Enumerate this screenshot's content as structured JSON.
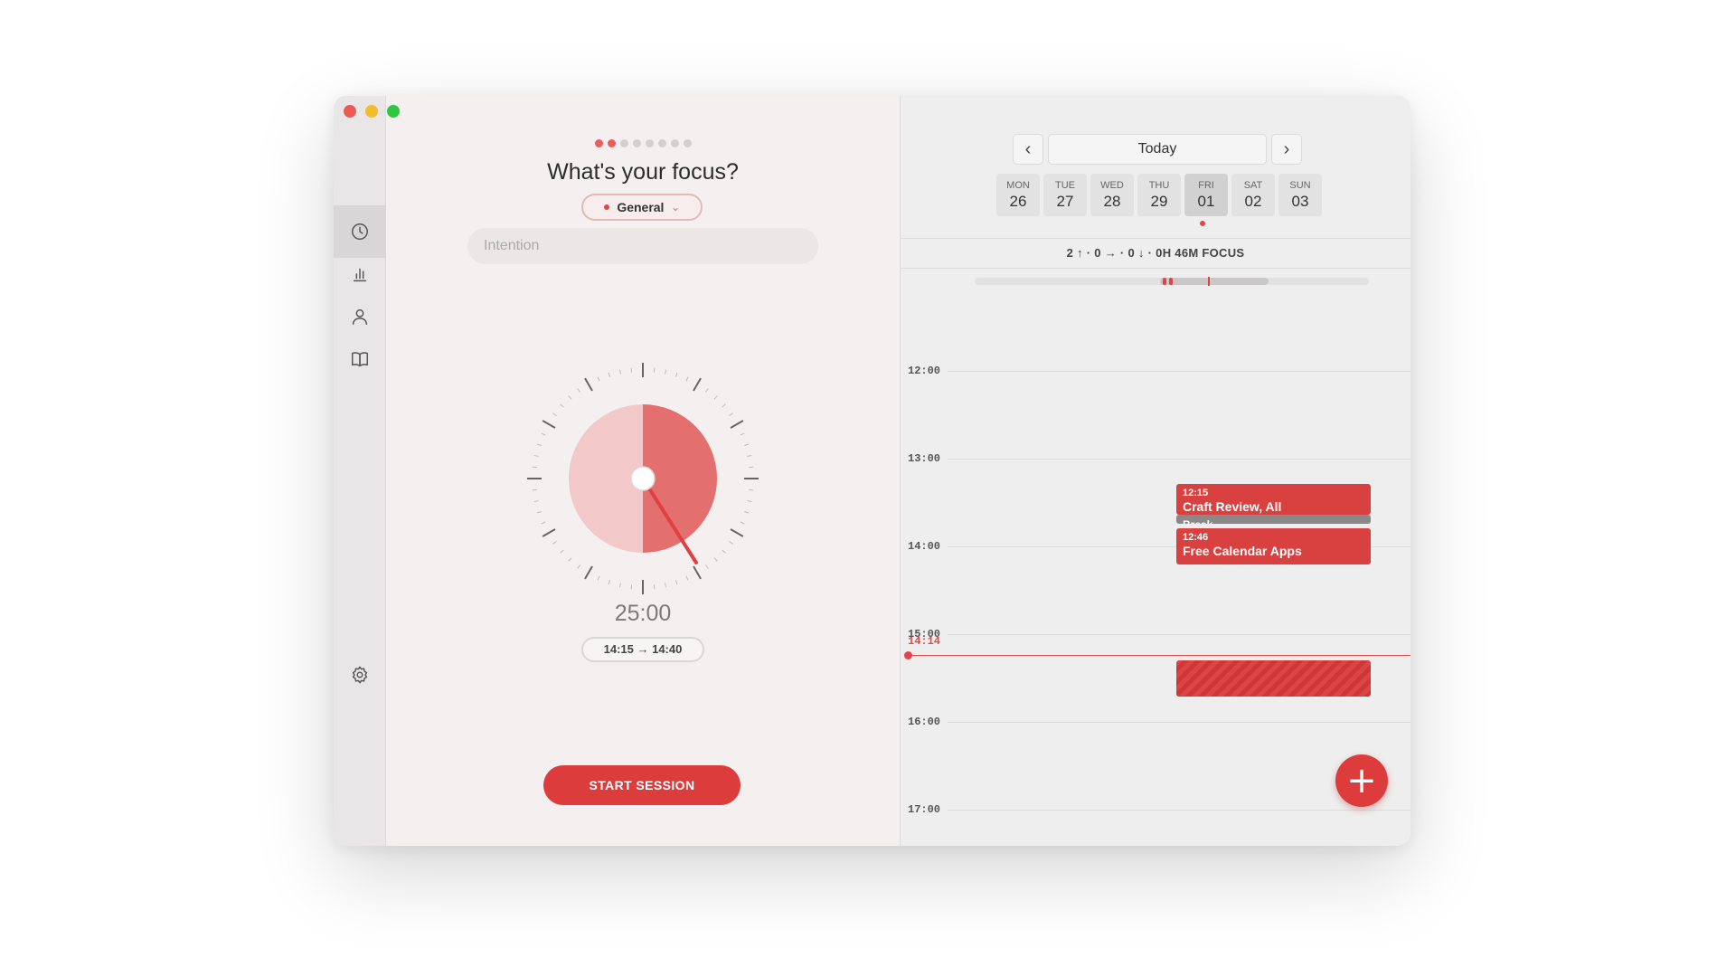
{
  "sidebar": {
    "icons": [
      "clock-icon",
      "chart-icon",
      "person-icon",
      "book-icon"
    ],
    "settings_icon": "gear-icon",
    "active_index": 0
  },
  "focus": {
    "page_count": 8,
    "page_active": [
      0,
      1
    ],
    "title": "What's your focus?",
    "tag_label": "General",
    "tag_color": "#e04848",
    "intention_placeholder": "Intention",
    "timer_duration": "25:00",
    "time_range": "14:15 → 14:40",
    "filled_fraction": 0.5,
    "start_button": "START SESSION"
  },
  "calendar": {
    "today_label": "Today",
    "prev_icon": "chevron-left-icon",
    "next_icon": "chevron-right-icon",
    "days": [
      {
        "name": "MON",
        "date": "26"
      },
      {
        "name": "TUE",
        "date": "27"
      },
      {
        "name": "WED",
        "date": "28"
      },
      {
        "name": "THU",
        "date": "29"
      },
      {
        "name": "FRI",
        "date": "01"
      },
      {
        "name": "SAT",
        "date": "02"
      },
      {
        "name": "SUN",
        "date": "03"
      }
    ],
    "selected_day_index": 4,
    "stats": "2 ↑ · 0 → · 0 ↓ · 0H 46M FOCUS",
    "hours": [
      "12:00",
      "13:00",
      "14:00",
      "15:00",
      "16:00",
      "17:00"
    ],
    "now_time": "14:14",
    "events": [
      {
        "time": "12:15",
        "name": "Craft Review, All"
      },
      {
        "time": "12:46",
        "name": "Free Calendar Apps"
      }
    ],
    "break_label": "Break",
    "add_icon": "plus-icon",
    "accent_color": "#dc3c3c"
  }
}
